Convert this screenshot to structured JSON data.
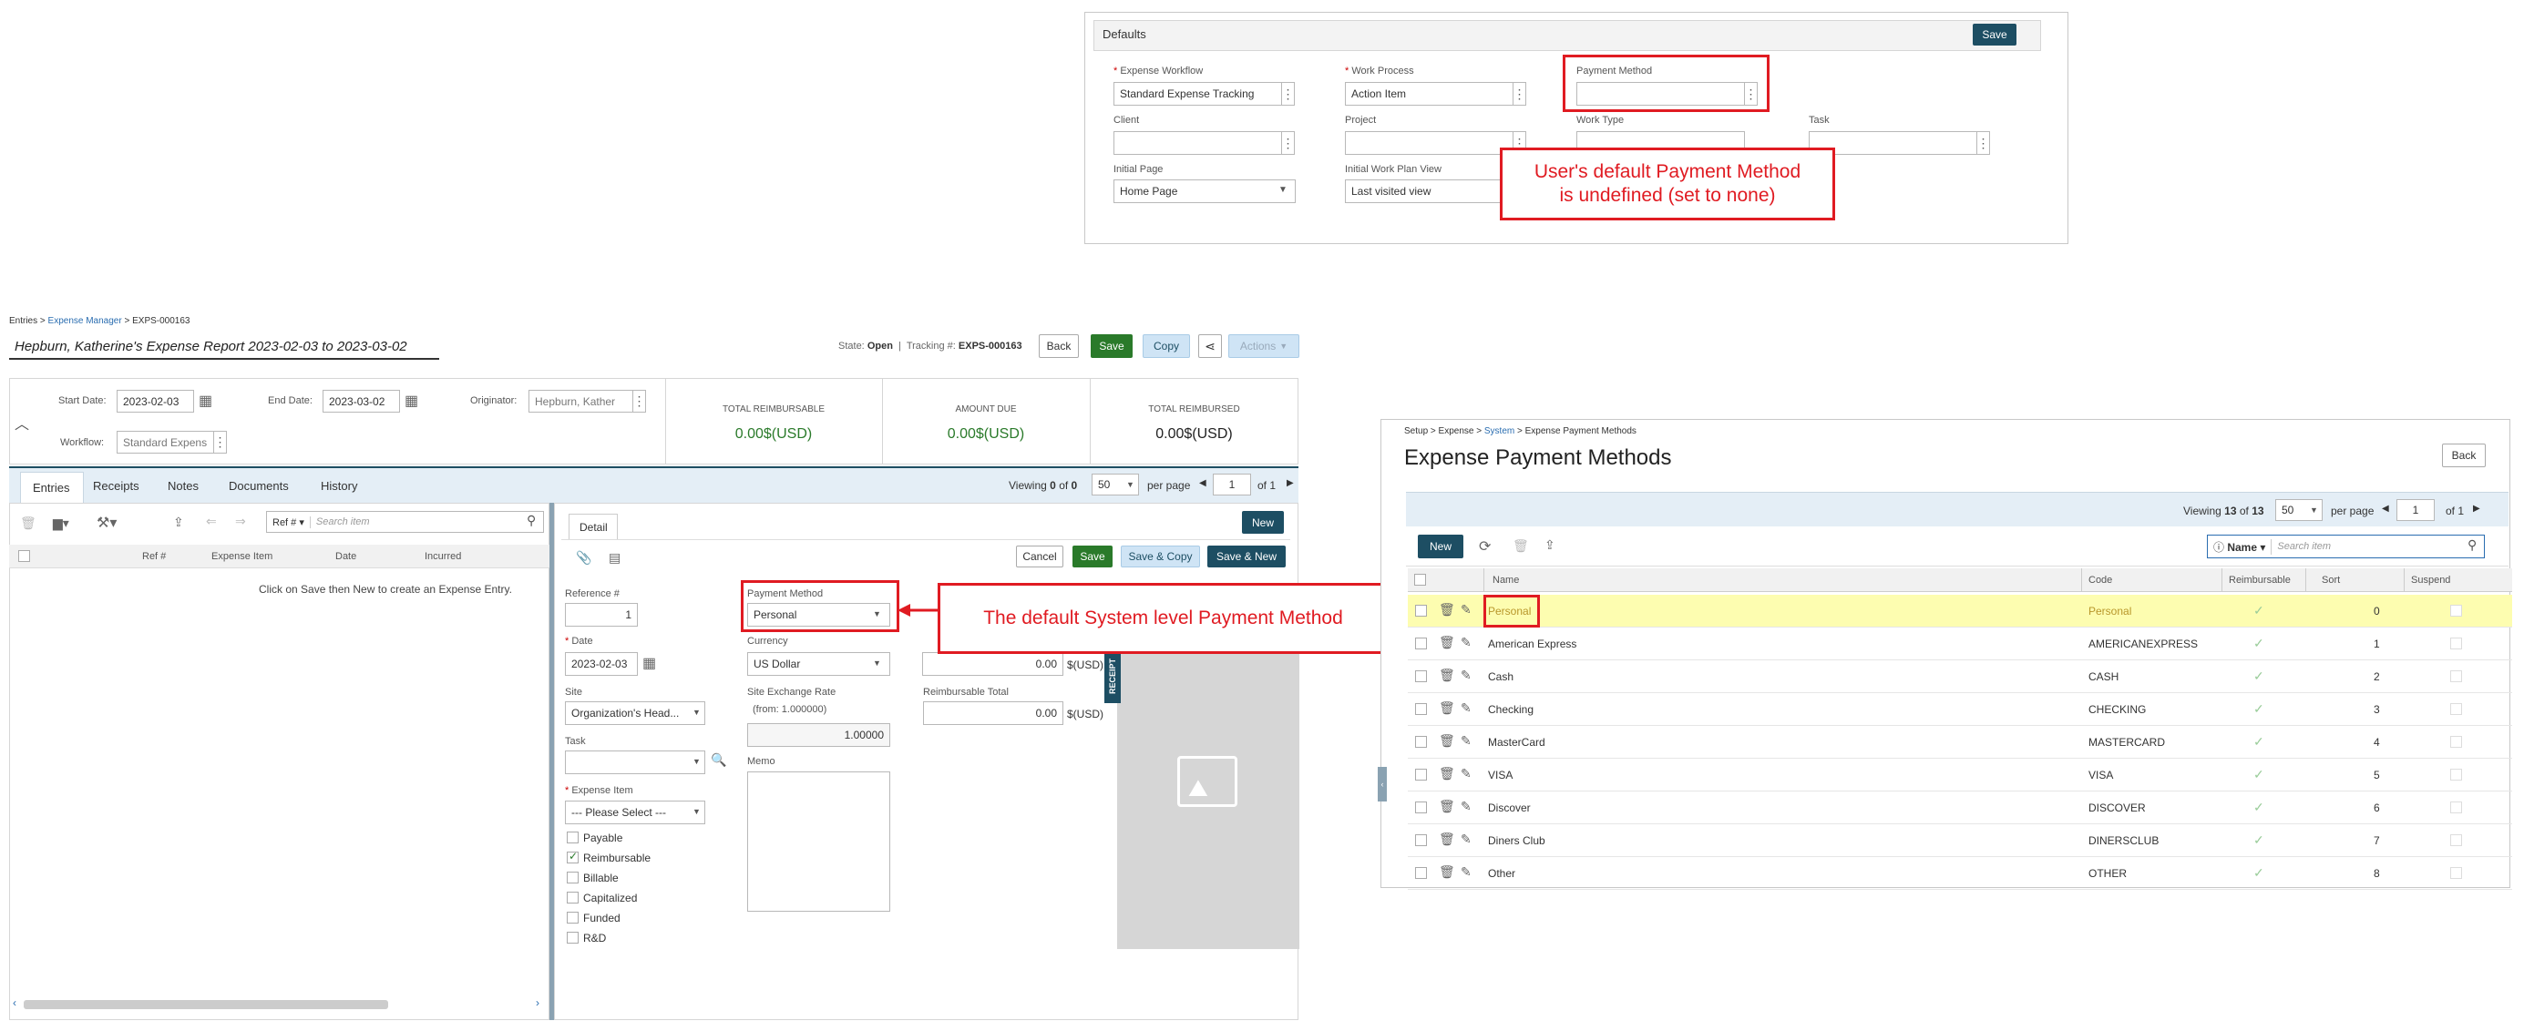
{
  "defaults_panel": {
    "title": "Defaults",
    "save_label": "Save",
    "fields": {
      "expense_workflow_label": "Expense Workflow",
      "expense_workflow_value": "Standard Expense Tracking",
      "work_process_label": "Work Process",
      "work_process_value": "Action Item",
      "payment_method_label": "Payment Method",
      "payment_method_value": "",
      "client_label": "Client",
      "project_label": "Project",
      "work_type_label": "Work Type",
      "task_label": "Task",
      "initial_page_label": "Initial Page",
      "initial_page_value": "Home Page",
      "initial_work_plan_label": "Initial Work Plan View",
      "initial_work_plan_value": "Last visited view"
    },
    "callout": "User's default Payment Method is undefined (set to none)"
  },
  "expense_report": {
    "breadcrumb": {
      "part1": "Entries",
      "sep1": ">",
      "part2": "Expense Manager",
      "sep2": ">",
      "part3": "EXPS-000163"
    },
    "title": "Hepburn, Katherine's Expense Report 2023-02-03 to 2023-03-02",
    "state_label": "State:",
    "state_value": "Open",
    "tracking_label": "Tracking #:",
    "tracking_value": "EXPS-000163",
    "buttons": {
      "back": "Back",
      "save": "Save",
      "copy": "Copy",
      "actions": "Actions"
    },
    "start_date_label": "Start Date:",
    "start_date_value": "2023-02-03",
    "end_date_label": "End Date:",
    "end_date_value": "2023-03-02",
    "originator_label": "Originator:",
    "originator_value": "Hepburn, Kather",
    "workflow_label": "Workflow:",
    "workflow_value": "Standard Expens",
    "totals": [
      {
        "label": "TOTAL REIMBURSABLE",
        "value": "0.00$(USD)"
      },
      {
        "label": "AMOUNT DUE",
        "value": "0.00$(USD)"
      },
      {
        "label": "TOTAL REIMBURSED",
        "value": "0.00$(USD)"
      }
    ],
    "tabs": [
      "Entries",
      "Receipts",
      "Notes",
      "Documents",
      "History"
    ],
    "viewing": {
      "prefix": "Viewing",
      "start": "0",
      "of_word": "of",
      "total": "0",
      "per_page_value": "50",
      "per_page_label": "per page",
      "page": "1",
      "of_pages": "of 1"
    },
    "search_field": "Ref #",
    "search_placeholder": "Search item",
    "columns": [
      "Ref #",
      "Expense Item",
      "Date",
      "Incurred"
    ],
    "empty_message": "Click on Save then New to create an Expense Entry.",
    "detail": {
      "tab_label": "Detail",
      "new_label": "New",
      "cancel_label": "Cancel",
      "save_label": "Save",
      "save_copy_label": "Save & Copy",
      "save_new_label": "Save & New",
      "reference_label": "Reference #",
      "reference_value": "1",
      "payment_method_label": "Payment Method",
      "payment_method_value": "Personal",
      "date_label": "Date",
      "date_value": "2023-02-03",
      "currency_label": "Currency",
      "currency_value": "US Dollar",
      "amount_value": "0.00",
      "amount_unit": "$(USD)",
      "site_label": "Site",
      "site_value": "Organization's Head...",
      "site_exchange_label": "Site Exchange Rate",
      "site_exchange_from": "(from: 1.000000)",
      "site_exchange_value": "1.00000",
      "reimbursable_total_label": "Reimbursable Total",
      "reimbursable_total_value": "0.00",
      "reimbursable_total_unit": "$(USD)",
      "task_label": "Task",
      "memo_label": "Memo",
      "expense_item_label": "Expense Item",
      "expense_item_value": "--- Please Select ---",
      "checkboxes": [
        {
          "label": "Payable",
          "checked": false
        },
        {
          "label": "Reimbursable",
          "checked": true
        },
        {
          "label": "Billable",
          "checked": false
        },
        {
          "label": "Capitalized",
          "checked": false
        },
        {
          "label": "Funded",
          "checked": false
        },
        {
          "label": "R&D",
          "checked": false
        }
      ],
      "receipt_tab": "RECEIPT"
    },
    "callout": "The default System level Payment Method"
  },
  "payment_methods": {
    "breadcrumb": {
      "part1": "Setup",
      "sep1": ">",
      "part2": "Expense",
      "sep2": ">",
      "part3": "System",
      "sep3": ">",
      "part4": "Expense Payment Methods"
    },
    "title": "Expense Payment Methods",
    "back_label": "Back",
    "viewing": {
      "prefix": "Viewing",
      "start": "13",
      "of_word": "of",
      "total": "13",
      "per_page_value": "50",
      "per_page_label": "per page",
      "page": "1",
      "of_pages": "of 1"
    },
    "new_label": "New",
    "search_field": "Name",
    "search_placeholder": "Search item",
    "columns": [
      "Name",
      "Code",
      "Reimbursable",
      "Sort",
      "Suspend"
    ],
    "rows": [
      {
        "name": "Personal",
        "code": "Personal",
        "sort": "0"
      },
      {
        "name": "American Express",
        "code": "AMERICANEXPRESS",
        "sort": "1"
      },
      {
        "name": "Cash",
        "code": "CASH",
        "sort": "2"
      },
      {
        "name": "Checking",
        "code": "CHECKING",
        "sort": "3"
      },
      {
        "name": "MasterCard",
        "code": "MASTERCARD",
        "sort": "4"
      },
      {
        "name": "VISA",
        "code": "VISA",
        "sort": "5"
      },
      {
        "name": "Discover",
        "code": "DISCOVER",
        "sort": "6"
      },
      {
        "name": "Diners Club",
        "code": "DINERSCLUB",
        "sort": "7"
      },
      {
        "name": "Other",
        "code": "OTHER",
        "sort": "8"
      }
    ]
  },
  "colors": {
    "accent": "#1d4e63",
    "save_green": "#2a7a2a",
    "annotation_red": "#e01b22",
    "highlight_row": "#fdfdb0"
  }
}
